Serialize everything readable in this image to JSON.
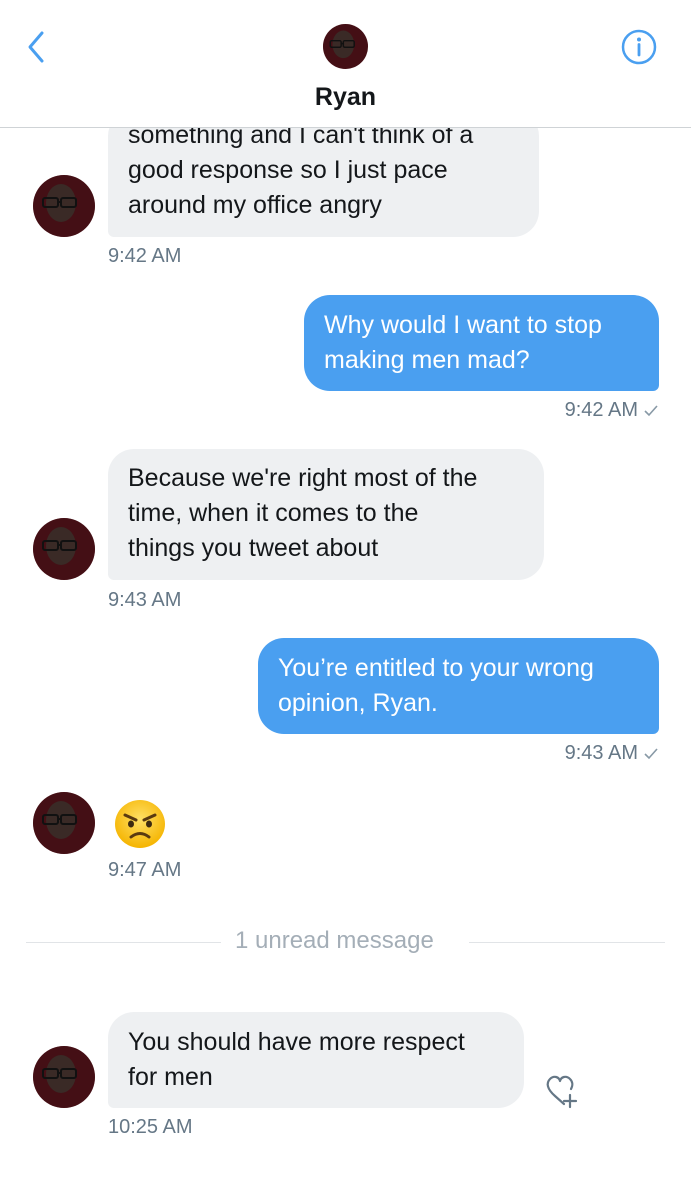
{
  "header": {
    "contact_name": "Ryan"
  },
  "messages": [
    {
      "direction": "incoming",
      "lines": [
        "something and I can't think of a",
        "good response so I just pace",
        "around my office angry"
      ],
      "time": "9:42 AM"
    },
    {
      "direction": "outgoing",
      "lines": [
        "Why would I want to stop",
        "making men mad?"
      ],
      "time": "9:42 AM"
    },
    {
      "direction": "incoming",
      "lines": [
        "Because we're right most of the",
        "time, when it comes to the",
        "things you tweet about"
      ],
      "time": "9:43 AM"
    },
    {
      "direction": "outgoing",
      "lines": [
        "You’re entitled to your wrong",
        "opinion, Ryan."
      ],
      "time": "9:43 AM"
    },
    {
      "direction": "incoming",
      "emoji": "angry-face",
      "time": "9:47 AM"
    },
    {
      "direction": "incoming",
      "lines": [
        "You should have more respect",
        "for men"
      ],
      "time": "10:25 AM"
    }
  ],
  "unread_divider": "1 unread message",
  "colors": {
    "accent_blue": "#4a9ff0",
    "incoming_bubble": "#eef0f2",
    "timestamp_gray": "#657786",
    "divider_text": "#a4aeb7"
  },
  "icons": {
    "back": "chevron-left-icon",
    "info": "info-icon",
    "read_receipt": "checkmark-icon",
    "react": "heart-plus-icon"
  }
}
